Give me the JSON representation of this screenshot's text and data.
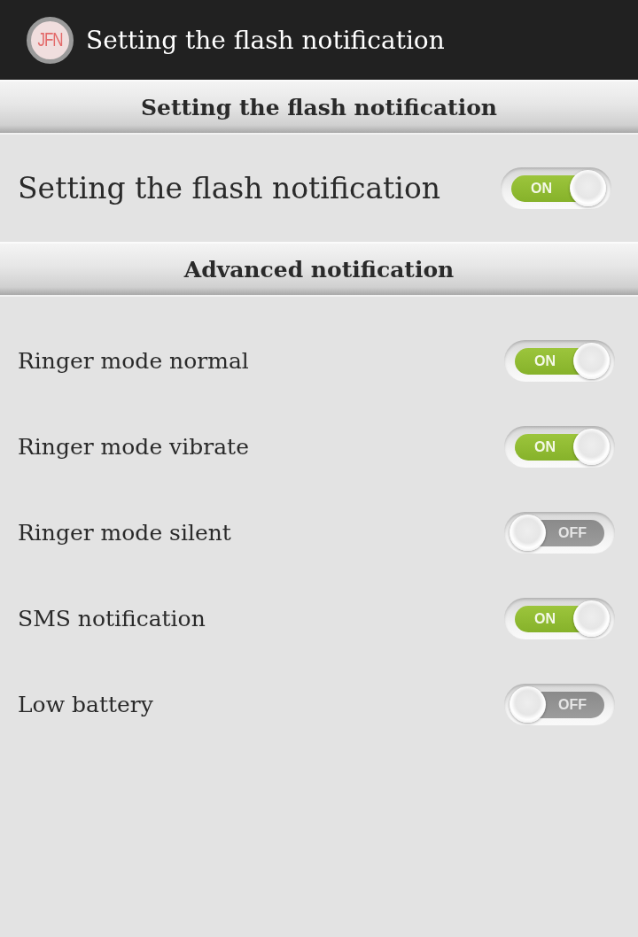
{
  "app_bar": {
    "logo_text": "JFN",
    "title": "Setting the flash notification"
  },
  "sections": [
    {
      "kind": "primary",
      "header": "Setting the flash notification",
      "items": [
        {
          "label": "Setting the flash notification",
          "switch": {
            "on": true,
            "text": "ON"
          }
        }
      ]
    },
    {
      "kind": "standard",
      "header": "Advanced notification",
      "items": [
        {
          "label": "Ringer mode normal",
          "switch": {
            "on": true,
            "text": "ON"
          }
        },
        {
          "label": "Ringer mode vibrate",
          "switch": {
            "on": true,
            "text": "ON"
          }
        },
        {
          "label": "Ringer mode silent",
          "switch": {
            "on": false,
            "text": "OFF"
          }
        },
        {
          "label": "SMS notification",
          "switch": {
            "on": true,
            "text": "ON"
          }
        },
        {
          "label": "Low battery",
          "switch": {
            "on": false,
            "text": "OFF"
          }
        }
      ]
    }
  ]
}
